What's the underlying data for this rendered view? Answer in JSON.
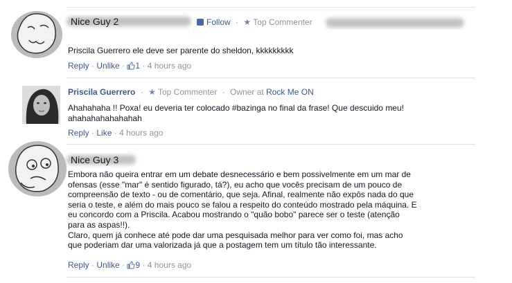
{
  "comments": [
    {
      "name": "Nice Guy 2",
      "follow_label": "Follow",
      "badge": "Top Commenter",
      "text": "Priscila Guerrero ele deve ser parente do sheldon, kkkkkkkkk",
      "reply": "Reply",
      "like_action": "Unlike",
      "likes": "1",
      "time": "4 hours ago"
    },
    {
      "name": "Priscila Guerrero",
      "badge": "Top Commenter",
      "owner_at": "Owner at",
      "page": "Rock Me ON",
      "text": "Ahahahaha !! Poxa! eu deveria ter colocado #bazinga no final da frase! Que descuido meu! ahahahahahahahah",
      "reply": "Reply",
      "like_action": "Like",
      "time": "4 hours ago"
    },
    {
      "name": "Nice Guy 3",
      "text_lines": [
        "Embora não queira entrar em um debate desnecessário e bem possivelmente em um mar de",
        "ofensas (esse \"mar\" é sentido figurado, tá?), eu acho que vocês precisam de um pouco de",
        "compreensão de texto - ou de comentário, que seja. Afinal, realmente não expôs nada do que",
        "seria o teste, e além do mais pouco se falou a respeito do conteúdo mostrado pela máquina. E",
        "eu concordo com a Priscila. Acabou mostrando o \"quão bobo\" parece ser o teste (atenção",
        "para as aspas!!).",
        "Claro, quem já conhece até pode dar uma pesquisada melhor para ver como foi, mas acho",
        "que poderiam dar uma valorizada já que a postagem tem um título tão interessante."
      ],
      "reply": "Reply",
      "like_action": "Unlike",
      "likes": "9",
      "time": "4 hours ago"
    }
  ]
}
